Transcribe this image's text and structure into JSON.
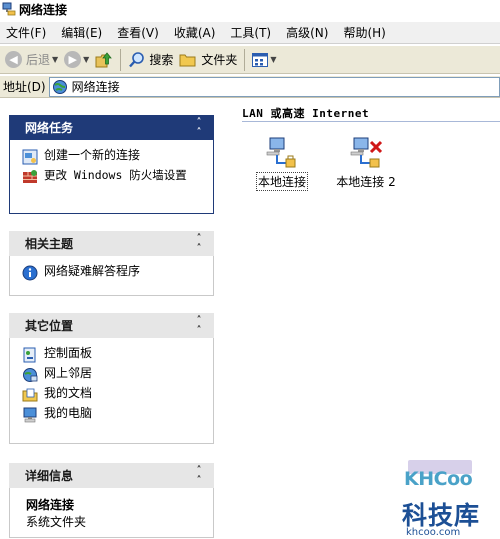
{
  "window": {
    "title": "网络连接"
  },
  "menu": [
    "文件(F)",
    "编辑(E)",
    "查看(V)",
    "收藏(A)",
    "工具(T)",
    "高级(N)",
    "帮助(H)"
  ],
  "toolbar": {
    "back_label": "后退",
    "search_label": "搜索",
    "folders_label": "文件夹"
  },
  "address": {
    "label": "地址(D)",
    "value": "网络连接"
  },
  "panels": {
    "network_tasks": {
      "title": "网络任务",
      "items": [
        "创建一个新的连接",
        "更改 Windows 防火墙设置"
      ]
    },
    "related": {
      "title": "相关主题",
      "items": [
        "网络疑难解答程序"
      ]
    },
    "other_places": {
      "title": "其它位置",
      "items": [
        "控制面板",
        "网上邻居",
        "我的文档",
        "我的电脑"
      ]
    },
    "details": {
      "title": "详细信息",
      "name": "网络连接",
      "type": "系统文件夹"
    }
  },
  "main": {
    "group_title": "LAN 或高速 Internet",
    "connections": [
      {
        "label": "本地连接",
        "status": "connected"
      },
      {
        "label": "本地连接 2",
        "status": "disconnected"
      }
    ]
  },
  "watermark": {
    "en": "KHCoo",
    "zh": "科技库",
    "url": "khcoo.com"
  },
  "colors": {
    "panel_header_blue": "#1f3a78",
    "toolbar_bg": "#ece9d8",
    "watermark_blue": "#1c4f95"
  }
}
